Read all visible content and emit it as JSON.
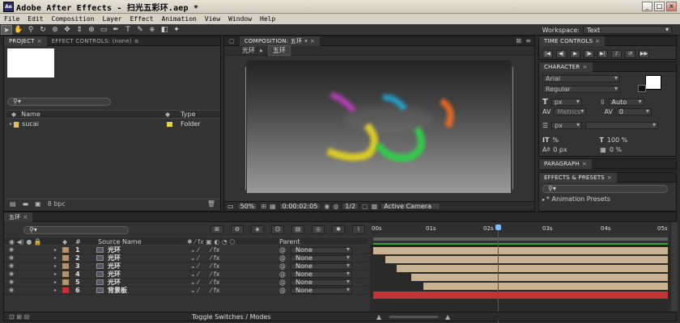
{
  "window": {
    "title": "Adobe After Effects - 扫光五彩环.aep *",
    "app_icon": "Ae"
  },
  "menu": [
    "File",
    "Edit",
    "Composition",
    "Layer",
    "Effect",
    "Animation",
    "View",
    "Window",
    "Help"
  ],
  "toolbar": {
    "workspace_label": "Workspace:",
    "workspace_value": "Text",
    "tools": [
      "selection-icon",
      "hand-icon",
      "zoom-icon",
      "rotate-icon",
      "orbit-camera-icon",
      "track-xy-icon",
      "track-z-icon",
      "pan-behind-icon",
      "rectangle-mask-icon",
      "pen-icon",
      "text-icon",
      "brush-icon",
      "clone-stamp-icon",
      "eraser-icon",
      "puppet-pin-icon"
    ]
  },
  "project": {
    "tabs": [
      "PROJECT",
      "EFFECT CONTROLS: (none)"
    ],
    "search_placeholder": "",
    "columns": [
      "Name",
      "Type"
    ],
    "items": [
      {
        "name": "sucai",
        "type": "Folder"
      }
    ],
    "bpc": "8 bpc"
  },
  "composition": {
    "tab": "COMPOSITION: 五环",
    "breadcrumbs": [
      "光环",
      "五环"
    ],
    "zoom": "50%",
    "timecode": "0:00:02:05",
    "resolution": "1/2",
    "camera": "Active Camera"
  },
  "time_controls": {
    "tab": "TIME CONTROLS",
    "buttons": [
      "first-frame-icon",
      "prev-frame-icon",
      "play-icon",
      "next-frame-icon",
      "last-frame-icon",
      "audio-icon",
      "loop-icon",
      "ram-preview-icon"
    ]
  },
  "character": {
    "tab": "CHARACTER",
    "font": "Arial",
    "style": "Regular",
    "size_unit": "px",
    "leading": "Auto",
    "kerning": "Metrics",
    "tracking": "0",
    "stroke_unit": "px",
    "vscale": "%",
    "hscale": "100 %",
    "baseline": "0 px",
    "tsume": "0 %"
  },
  "paragraph": {
    "tab": "PARAGRAPH"
  },
  "effects": {
    "tab": "EFFECTS & PRESETS",
    "item": "* Animation Presets"
  },
  "timeline": {
    "tab": "五环",
    "columns": {
      "source": "Source Name",
      "parent": "Parent"
    },
    "ruler": [
      "00s",
      "01s",
      "02s",
      "03s",
      "04s",
      "05s"
    ],
    "toggle_label": "Toggle Switches / Modes",
    "layers": [
      {
        "num": "1",
        "name": "光环",
        "parent": "None",
        "label_color": "#b3946a",
        "bar_color": "#c8b292",
        "bar_start": 0.0
      },
      {
        "num": "2",
        "name": "光环",
        "parent": "None",
        "label_color": "#b3946a",
        "bar_color": "#c8b292",
        "bar_start": 0.04
      },
      {
        "num": "3",
        "name": "光环",
        "parent": "None",
        "label_color": "#b3946a",
        "bar_color": "#c8b292",
        "bar_start": 0.08
      },
      {
        "num": "4",
        "name": "光环",
        "parent": "None",
        "label_color": "#b3946a",
        "bar_color": "#c8b292",
        "bar_start": 0.13
      },
      {
        "num": "5",
        "name": "光环",
        "parent": "None",
        "label_color": "#b3946a",
        "bar_color": "#c8b292",
        "bar_start": 0.17
      },
      {
        "num": "6",
        "name": "背景板",
        "parent": "None",
        "label_color": "#c83232",
        "bar_color": "#c23333",
        "bar_start": 0.0
      }
    ]
  }
}
